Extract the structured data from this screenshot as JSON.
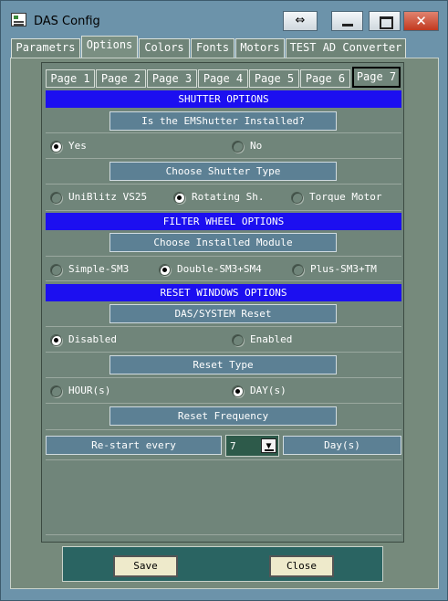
{
  "window": {
    "title": "DAS Config",
    "restore_icon": "⇔",
    "close_icon": "✕"
  },
  "main_tabs": [
    "Parametrs",
    "Options",
    "Colors",
    "Fonts",
    "Motors",
    "TEST AD Converter"
  ],
  "page_tabs": [
    "Page 1",
    "Page 2",
    "Page 3",
    "Page 4",
    "Page 5",
    "Page 6",
    "Page 7"
  ],
  "shutter": {
    "header": "SHUTTER OPTIONS",
    "installed_button": "Is the EMShutter Installed?",
    "yes": "Yes",
    "no": "No",
    "type_button": "Choose Shutter Type",
    "types": [
      "UniBlitz VS25",
      "Rotating Sh.",
      "Torque Motor"
    ]
  },
  "filter": {
    "header": "FILTER WHEEL OPTIONS",
    "module_button": "Choose Installed Module",
    "modules": [
      "Simple-SM3",
      "Double-SM3+SM4",
      "Plus-SM3+TM"
    ]
  },
  "reset": {
    "header": "RESET WINDOWS OPTIONS",
    "das_button": "DAS/SYSTEM Reset",
    "disabled": "Disabled",
    "enabled": "Enabled",
    "type_button": "Reset Type",
    "hours": "HOUR(s)",
    "days": "DAY(s)",
    "frequency_button": "Reset Frequency",
    "restart_label": "Re-start every",
    "restart_value": "7",
    "unit_label": "Day(s)"
  },
  "footer": {
    "save": "Save",
    "close": "Close"
  }
}
